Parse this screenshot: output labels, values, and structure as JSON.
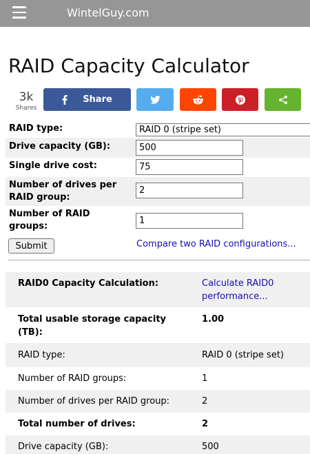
{
  "header": {
    "site_title": "WintelGuy.com",
    "menu_icon": "hamburger-menu-icon",
    "background": "#969696"
  },
  "page": {
    "title": "RAID Capacity Calculator"
  },
  "share": {
    "count": "3k",
    "count_label": "Shares",
    "facebook_label": "Share",
    "colors": {
      "facebook": "#3b5998",
      "twitter": "#55acee",
      "reddit": "#ff4500",
      "pinterest": "#cb2027",
      "sharethis": "#65b32e"
    },
    "icons": [
      "facebook-icon",
      "twitter-icon",
      "reddit-icon",
      "pinterest-icon",
      "share-icon"
    ]
  },
  "form": {
    "raid_type_label": "RAID type:",
    "raid_type_value": "RAID 0 (stripe set)",
    "drive_capacity_label": "Drive capacity (GB):",
    "drive_capacity_value": "500",
    "drive_cost_label": "Single drive cost:",
    "drive_cost_value": "75",
    "drives_per_group_label_1": "Number of drives per",
    "drives_per_group_label_2": "RAID group:",
    "drives_per_group_value": "2",
    "raid_groups_label_1": "Number of RAID",
    "raid_groups_label_2": "groups:",
    "raid_groups_value": "1",
    "submit_label": "Submit",
    "compare_link": "Compare two RAID configurations..."
  },
  "results": {
    "heading": "RAID0 Capacity Calculation:",
    "performance_link_1": "Calculate RAID0",
    "performance_link_2": "performance...",
    "rows": [
      {
        "label_1": "Total usable storage capacity",
        "label_2": "(TB):",
        "value": "1.00"
      },
      {
        "label": "RAID type:",
        "value": "RAID 0 (stripe set)"
      },
      {
        "label": "Number of RAID groups:",
        "value": "1"
      },
      {
        "label": "Number of drives per RAID group:",
        "value": "2"
      },
      {
        "label": "Total number of drives:",
        "value": "2"
      },
      {
        "label": "Drive capacity (GB):",
        "value": "500"
      }
    ]
  },
  "link_color": "#1a0dab"
}
